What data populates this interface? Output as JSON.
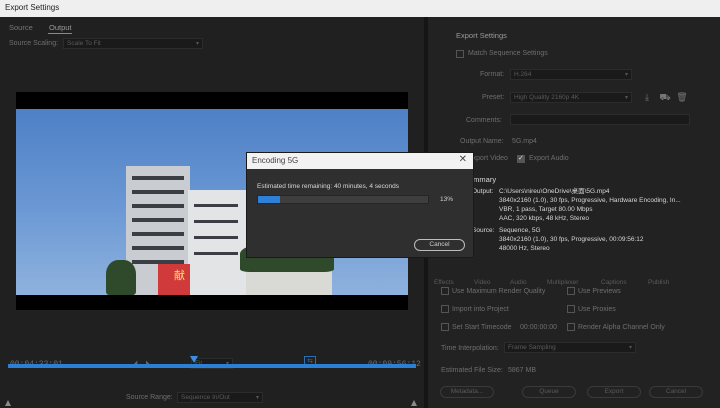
{
  "window": {
    "title": "Export Settings"
  },
  "left": {
    "tabs": [
      {
        "label": "Source"
      },
      {
        "label": "Output"
      }
    ],
    "source_scaling_label": "Source Scaling:",
    "source_scaling_value": "Scale To Fit",
    "timecode_in": "00:04:33:01",
    "timecode_out": "00:09:56:12",
    "fit_value": "Fit",
    "source_range_label": "Source Range:",
    "source_range_value": "Sequence In/Out",
    "playhead_fraction": 0.455,
    "sign_text": "献"
  },
  "export_settings": {
    "section_title": "Export Settings",
    "match_sequence_label": "Match Sequence Settings",
    "format_label": "Format:",
    "format_value": "H.264",
    "preset_label": "Preset:",
    "preset_value": "High Quality 2160p 4K",
    "comments_label": "Comments:",
    "output_name_label": "Output Name:",
    "output_name_value": "5G.mp4",
    "export_video_label": "Export Video",
    "export_audio_label": "Export Audio",
    "summary_title": "Summary",
    "output_key": "Output:",
    "output_lines": "C:\\Users\\nireu\\OneDrive\\桌面\\5G.mp4\n3840x2160 (1.0), 30 fps, Progressive, Hardware Encoding, In...\nVBR, 1 pass, Target 80.00 Mbps\nAAC, 320 kbps, 48 kHz, Stereo",
    "source_key": "Source:",
    "source_lines": "Sequence, 5G\n3840x2160 (1.0), 30 fps, Progressive, 00:09:56:12\n48000 Hz, Stereo"
  },
  "lower_tabs": [
    "Effects",
    "Video",
    "Audio",
    "Multiplexer",
    "Captions",
    "Publish"
  ],
  "options": {
    "max_render": "Use Maximum Render Quality",
    "use_previews": "Use Previews",
    "import_project": "Import into Project",
    "use_proxies": "Use Proxies",
    "set_start_tc": "Set Start Timecode",
    "start_tc_value": "00:00:00:00",
    "render_alpha": "Render Alpha Channel Only",
    "interp_label": "Time Interpolation:",
    "interp_value": "Frame Sampling",
    "file_size_label": "Estimated File Size:",
    "file_size_value": "5867 MB"
  },
  "buttons": {
    "metadata": "Metadata...",
    "queue": "Queue",
    "export": "Export",
    "cancel": "Cancel"
  },
  "dialog": {
    "title": "Encoding 5G",
    "message": "Estimated time remaining: 40 minutes, 4 seconds",
    "progress": 0.13,
    "progress_text": "13%",
    "cancel_label": "Cancel"
  },
  "colors": {
    "accent": "#2f80d8"
  }
}
